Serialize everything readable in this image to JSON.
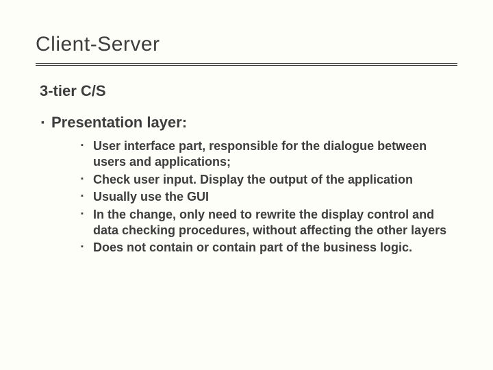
{
  "title": "Client-Server",
  "subtitle": "3-tier C/S",
  "section_heading": "Presentation layer:",
  "bullets": [
    "User interface part, responsible for the dialogue between users and applications;",
    "Check user input. Display the output of the application",
    "Usually use the GUI",
    "In the change, only need to rewrite the display control and data checking procedures, without affecting the other layers",
    "Does not contain or contain part of the business logic."
  ]
}
